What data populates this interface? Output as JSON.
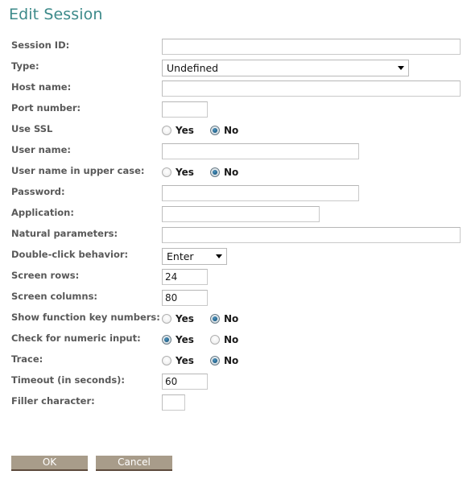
{
  "page": {
    "title": "Edit Session",
    "title_color": "#3d8a8a",
    "background_color": "#ffffff",
    "label_color": "#595959"
  },
  "form": {
    "rows": [
      {
        "label": "Session ID:",
        "control": "text",
        "value": ""
      },
      {
        "label": "Type:",
        "control": "select",
        "value": "Undefined"
      },
      {
        "label": "Host name:",
        "control": "text",
        "value": ""
      },
      {
        "label": "Port number:",
        "control": "text",
        "value": ""
      },
      {
        "label": "Use SSL",
        "control": "radio",
        "value": "No"
      },
      {
        "label": "User name:",
        "control": "text",
        "value": ""
      },
      {
        "label": "User name in upper case:",
        "control": "radio",
        "value": "No"
      },
      {
        "label": "Password:",
        "control": "text",
        "value": ""
      },
      {
        "label": "Application:",
        "control": "text",
        "value": ""
      },
      {
        "label": "Natural parameters:",
        "control": "text",
        "value": ""
      },
      {
        "label": "Double-click behavior:",
        "control": "select",
        "value": "Enter"
      },
      {
        "label": "Screen rows:",
        "control": "text",
        "value": "24"
      },
      {
        "label": "Screen columns:",
        "control": "text",
        "value": "80"
      },
      {
        "label": "Show function key numbers:",
        "control": "radio",
        "value": "No"
      },
      {
        "label": "Check for numeric input:",
        "control": "radio",
        "value": "Yes"
      },
      {
        "label": "Trace:",
        "control": "radio",
        "value": "No"
      },
      {
        "label": "Timeout (in seconds):",
        "control": "text",
        "value": "60"
      },
      {
        "label": "Filler character:",
        "control": "text",
        "value": ""
      }
    ],
    "radio_options": {
      "yes": "Yes",
      "no": "No"
    },
    "placeholders": {
      "session_id": "",
      "host_name": "",
      "port_number": "",
      "user_name": "",
      "password": "",
      "application": "",
      "natural_parameters": "",
      "filler_character": ""
    }
  },
  "buttons": {
    "ok": "OK",
    "cancel": "Cancel",
    "background_color": "#a89c8a",
    "text_color": "#ffffff"
  }
}
